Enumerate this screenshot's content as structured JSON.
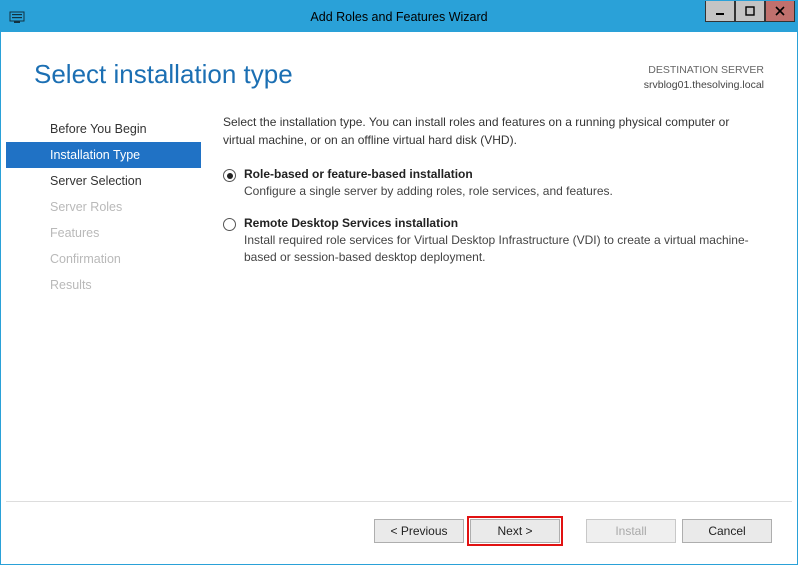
{
  "window": {
    "title": "Add Roles and Features Wizard"
  },
  "header": {
    "page_title": "Select installation type",
    "destination_label": "DESTINATION SERVER",
    "destination_value": "srvblog01.thesolving.local"
  },
  "sidebar": {
    "items": [
      {
        "label": "Before You Begin",
        "state": "enabled"
      },
      {
        "label": "Installation Type",
        "state": "selected"
      },
      {
        "label": "Server Selection",
        "state": "enabled"
      },
      {
        "label": "Server Roles",
        "state": "disabled"
      },
      {
        "label": "Features",
        "state": "disabled"
      },
      {
        "label": "Confirmation",
        "state": "disabled"
      },
      {
        "label": "Results",
        "state": "disabled"
      }
    ]
  },
  "main": {
    "intro": "Select the installation type. You can install roles and features on a running physical computer or virtual machine, or on an offline virtual hard disk (VHD).",
    "options": [
      {
        "title": "Role-based or feature-based installation",
        "desc": "Configure a single server by adding roles, role services, and features.",
        "checked": true
      },
      {
        "title": "Remote Desktop Services installation",
        "desc": "Install required role services for Virtual Desktop Infrastructure (VDI) to create a virtual machine-based or session-based desktop deployment.",
        "checked": false
      }
    ]
  },
  "footer": {
    "previous": "< Previous",
    "next": "Next >",
    "install": "Install",
    "cancel": "Cancel"
  }
}
